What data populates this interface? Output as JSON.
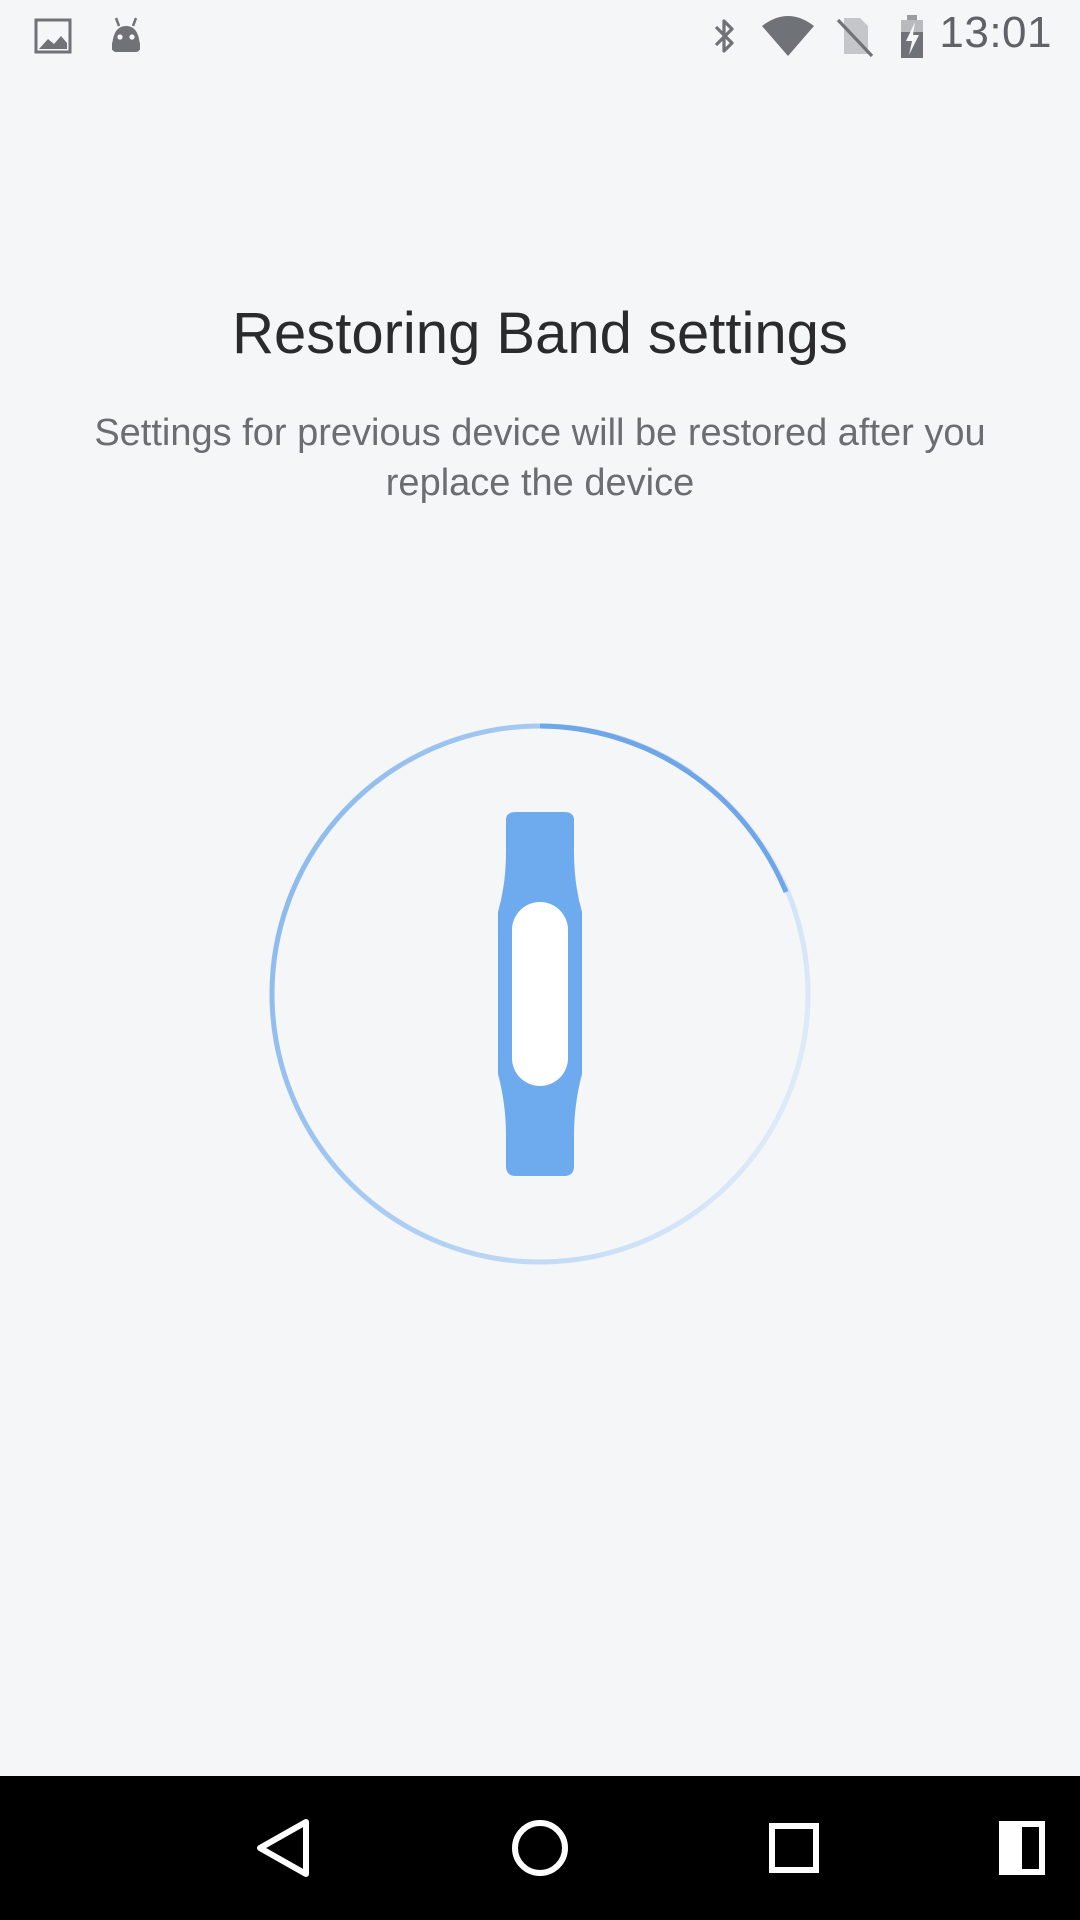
{
  "status_bar": {
    "left_icons": [
      "image-notification-icon",
      "android-notification-icon"
    ],
    "right_icons": [
      "bluetooth-icon",
      "wifi-icon",
      "no-sim-icon",
      "battery-charging-icon"
    ],
    "time": "13:01"
  },
  "main": {
    "title": "Restoring Band settings",
    "subtitle_line1": "Settings for previous device will be restored after you",
    "subtitle_line2": "replace the device",
    "progress_icon": "fitness-band-icon",
    "accent_color": "#6eaaee"
  },
  "nav_bar": {
    "buttons": [
      "back-icon",
      "home-icon",
      "recents-icon",
      "split-screen-icon"
    ]
  }
}
